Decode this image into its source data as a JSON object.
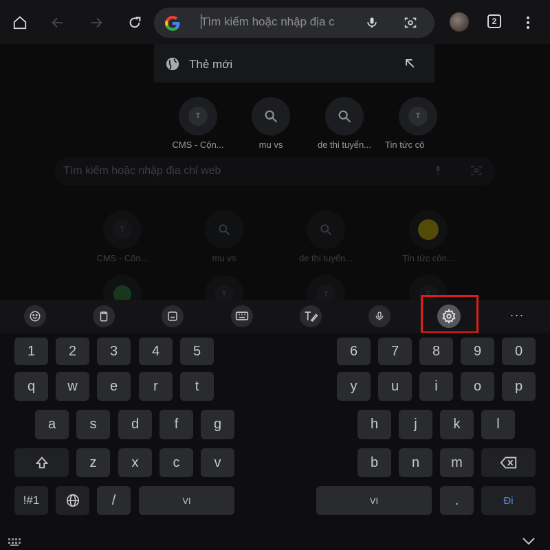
{
  "toolbar": {
    "search_placeholder": "Tìm kiếm hoặc nhập địa c",
    "tab_count": "2"
  },
  "suggestion": {
    "label": "Thẻ mới"
  },
  "tiles_front": [
    {
      "label": "CMS - Cộn...",
      "letter": "T",
      "kind": "letter"
    },
    {
      "label": "mu vs",
      "kind": "search"
    },
    {
      "label": "de thi tuyển...",
      "kind": "search"
    },
    {
      "label": "Tin tức cô",
      "letter": "T",
      "kind": "letter"
    }
  ],
  "background": {
    "search_placeholder": "Tìm kiếm hoặc nhập địa chỉ web",
    "tiles": [
      {
        "label": "CMS - Côn...",
        "letter": "T"
      },
      {
        "label": "mu vs"
      },
      {
        "label": "de thi tuyển..."
      },
      {
        "label": "Tin tức côn..."
      }
    ],
    "row2_letters": [
      "T",
      "T",
      "T"
    ]
  },
  "keyboard": {
    "toolbar_icons": [
      "emoji-icon",
      "clipboard-icon",
      "sticker-icon",
      "keyboard-icon",
      "handwriting-icon",
      "mic-icon",
      "settings-icon",
      "more-icon"
    ],
    "more_label": "···",
    "left": {
      "row1": [
        "1",
        "2",
        "3",
        "4",
        "5"
      ],
      "row2": [
        "q",
        "w",
        "e",
        "r",
        "t"
      ],
      "row3": [
        "a",
        "s",
        "d",
        "f",
        "g"
      ],
      "row4": [
        "z",
        "x",
        "c",
        "v"
      ],
      "row5_sym": "!#1",
      "row5_slash": "/",
      "row5_space": "VI"
    },
    "right": {
      "row1": [
        "6",
        "7",
        "8",
        "9",
        "0"
      ],
      "row2": [
        "y",
        "u",
        "i",
        "o",
        "p"
      ],
      "row3": [
        "h",
        "j",
        "k",
        "l"
      ],
      "row4": [
        "b",
        "n",
        "m"
      ],
      "row5_space": "VI",
      "row5_period": ".",
      "row5_go": "Đi"
    }
  },
  "colors": {
    "highlight": "#e11b1b",
    "go_text": "#5b8fd6"
  }
}
